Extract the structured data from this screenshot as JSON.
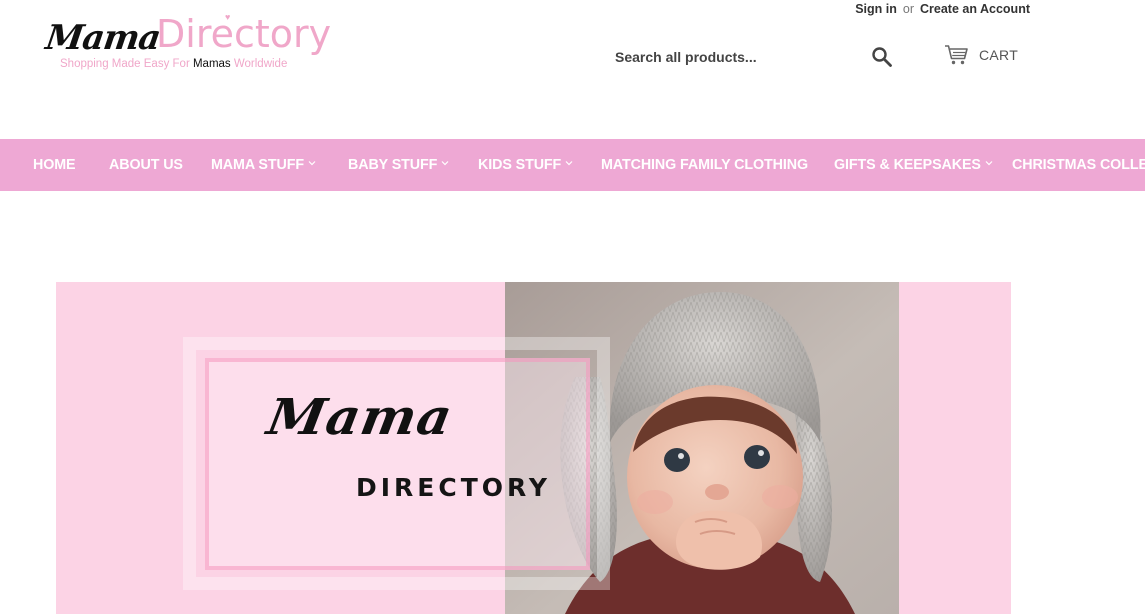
{
  "brand": {
    "logo_script": "Mama",
    "logo_word": "Directory",
    "tagline_before": "Shopping Made Easy For ",
    "tagline_emphasis": "Mamas",
    "tagline_after": " Worldwide",
    "brand_pink": "#f0a7c9"
  },
  "account": {
    "sign_in": "Sign in",
    "or": "or",
    "create_account": "Create an Account"
  },
  "search": {
    "placeholder": "Search all products...",
    "icon": "search-icon"
  },
  "cart": {
    "label": "CART",
    "icon": "cart-icon"
  },
  "nav": {
    "background": "#eea8d4",
    "items": [
      {
        "label": "HOME",
        "dropdown": false
      },
      {
        "label": "ABOUT US",
        "dropdown": false
      },
      {
        "label": "MAMA STUFF",
        "dropdown": true
      },
      {
        "label": "BABY STUFF",
        "dropdown": true
      },
      {
        "label": "KIDS STUFF",
        "dropdown": true
      },
      {
        "label": "MATCHING FAMILY CLOTHING",
        "dropdown": false
      },
      {
        "label": "GIFTS & KEEPSAKES",
        "dropdown": true
      },
      {
        "label": "CHRISTMAS COLLECTION",
        "dropdown": false
      }
    ]
  },
  "hero": {
    "script_text": "Mama",
    "caps_text": "DIRECTORY",
    "background": "#fcd3e5",
    "photo": "baby-in-knit-bunny-hat"
  }
}
